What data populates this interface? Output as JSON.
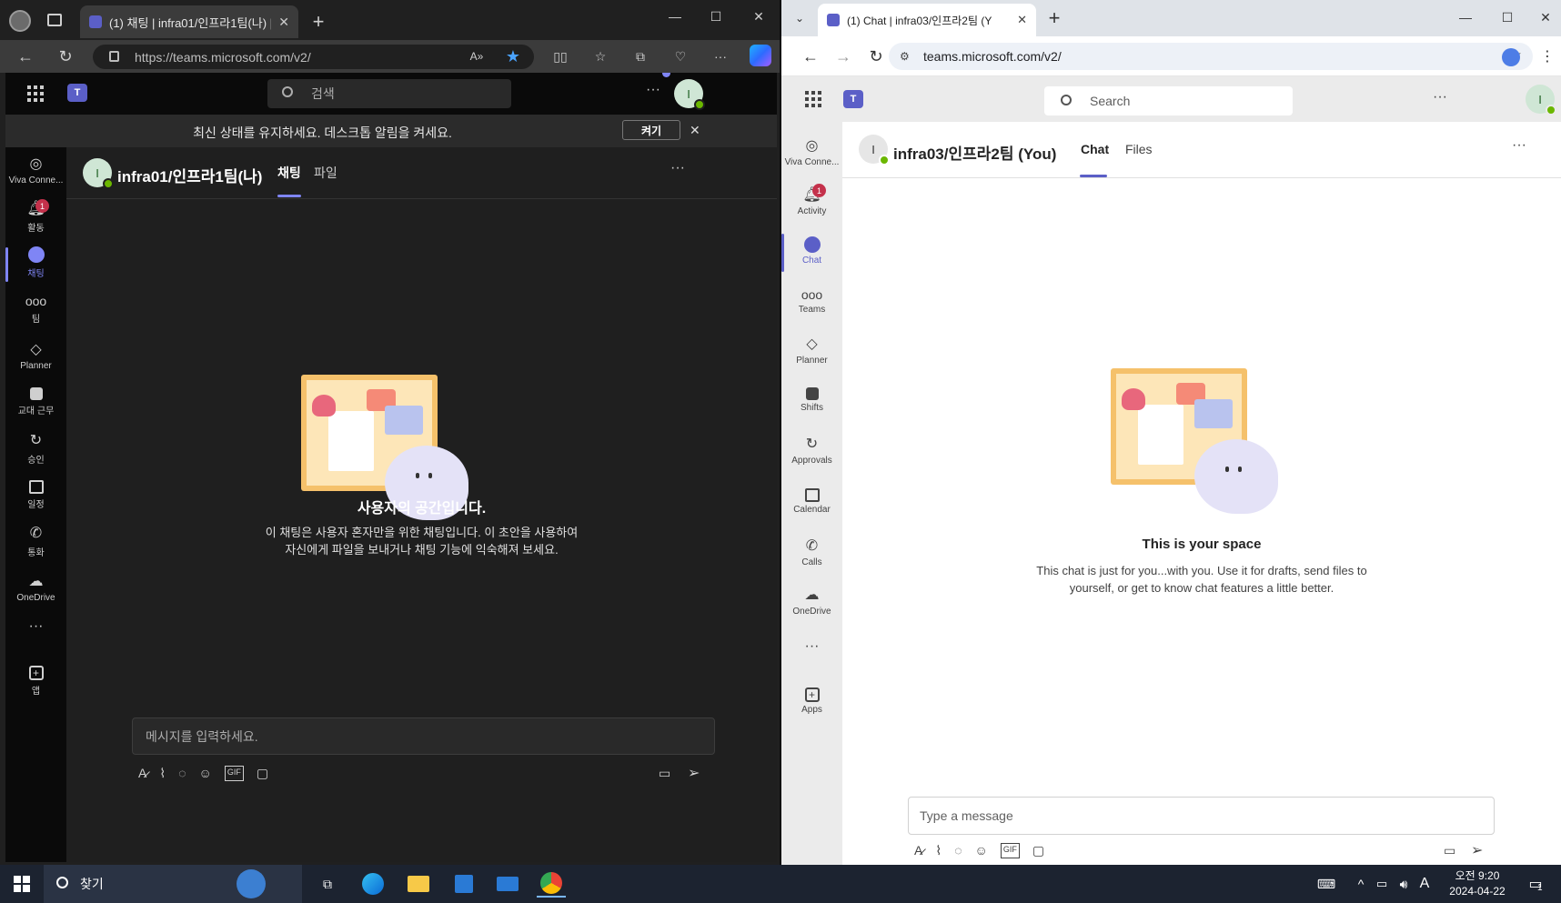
{
  "left": {
    "tab_title": "(1) 채팅 | infra01/인프라1팀(나) |",
    "url": "https://teams.microsoft.com/v2/",
    "search_placeholder": "검색",
    "avatar_initial": "I",
    "banner_text": "최신 상태를 유지하세요. 데스크톱 알림을 켜세요.",
    "banner_button": "켜기",
    "rail": [
      {
        "label": "Viva Conne...",
        "icon": "viva-icon"
      },
      {
        "label": "활동",
        "icon": "bell-icon",
        "badge": "1"
      },
      {
        "label": "채팅",
        "icon": "chat-icon"
      },
      {
        "label": "팀",
        "icon": "teams-icon"
      },
      {
        "label": "Planner",
        "icon": "planner-icon"
      },
      {
        "label": "교대 근무",
        "icon": "shifts-icon"
      },
      {
        "label": "승인",
        "icon": "approvals-icon"
      },
      {
        "label": "일정",
        "icon": "calendar-icon"
      },
      {
        "label": "통화",
        "icon": "phone-icon"
      },
      {
        "label": "OneDrive",
        "icon": "cloud-icon"
      },
      {
        "label": "앱",
        "icon": "apps-icon"
      }
    ],
    "chat_title": "infra01/인프라1팀(나)",
    "tab_chat": "채팅",
    "tab_files": "파일",
    "empty_title": "사용자의 공간입니다.",
    "empty_line1": "이 채팅은 사용자 혼자만을 위한 채팅입니다. 이 초안을 사용하여",
    "empty_line2": "자신에게 파일을 보내거나 채팅 기능에 익숙해져 보세요.",
    "compose_placeholder": "메시지를 입력하세요."
  },
  "right": {
    "tab_title": "(1) Chat | infra03/인프라2팀 (Y",
    "url": "teams.microsoft.com/v2/",
    "search_placeholder": "Search",
    "avatar_initial": "I",
    "rail": [
      {
        "label": "Viva Conne...",
        "icon": "viva-icon"
      },
      {
        "label": "Activity",
        "icon": "bell-icon",
        "badge": "1"
      },
      {
        "label": "Chat",
        "icon": "chat-icon"
      },
      {
        "label": "Teams",
        "icon": "teams-icon"
      },
      {
        "label": "Planner",
        "icon": "planner-icon"
      },
      {
        "label": "Shifts",
        "icon": "shifts-icon"
      },
      {
        "label": "Approvals",
        "icon": "approvals-icon"
      },
      {
        "label": "Calendar",
        "icon": "calendar-icon"
      },
      {
        "label": "Calls",
        "icon": "phone-icon"
      },
      {
        "label": "OneDrive",
        "icon": "cloud-icon"
      },
      {
        "label": "Apps",
        "icon": "apps-icon"
      }
    ],
    "chat_title": "infra03/인프라2팀 (You)",
    "tab_chat": "Chat",
    "tab_files": "Files",
    "empty_title": "This is your space",
    "empty_line1": "This chat is just for you...with you. Use it for drafts, send files to",
    "empty_line2": "yourself, or get to know chat features a little better.",
    "compose_placeholder": "Type a message"
  },
  "taskbar": {
    "search_label": "찾기",
    "clock_time": "오전 9:20",
    "clock_date": "2024-04-22",
    "ime": "A",
    "notification_count": "1"
  },
  "colors": {
    "accent_dark": "#7f85f5",
    "accent_light": "#5b5fc7",
    "badge": "#c4314b",
    "presence": "#6bb700"
  }
}
